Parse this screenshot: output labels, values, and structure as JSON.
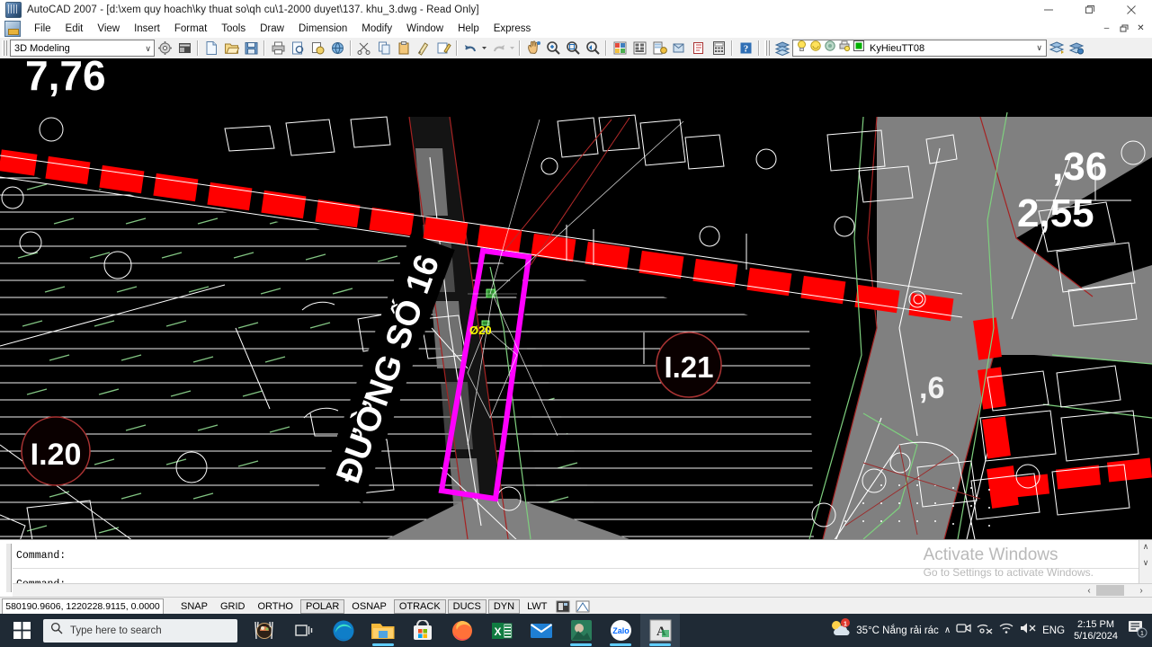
{
  "titlebar": {
    "text": "AutoCAD 2007 - [d:\\xem quy hoach\\ky thuat so\\qh cu\\1-2000 duyet\\137. khu_3.dwg - Read Only]",
    "icon": "autocad-app-icon",
    "minimize": "—",
    "maximize": "❐",
    "close": "✕"
  },
  "menubar": {
    "items": [
      {
        "label": "File"
      },
      {
        "label": "Edit"
      },
      {
        "label": "View"
      },
      {
        "label": "Insert"
      },
      {
        "label": "Format"
      },
      {
        "label": "Tools"
      },
      {
        "label": "Draw"
      },
      {
        "label": "Dimension"
      },
      {
        "label": "Modify"
      },
      {
        "label": "Window"
      },
      {
        "label": "Help"
      },
      {
        "label": "Express"
      }
    ],
    "doc_controls": {
      "minimize": "–",
      "restore": "❐",
      "close": "✕"
    }
  },
  "toolbar": {
    "workspace": {
      "value": "3D Modeling",
      "arrow": "∨"
    },
    "layer": {
      "value": "KyHieuTT08",
      "arrow": "∨"
    },
    "buttons": [
      {
        "name": "workspace-settings-icon"
      },
      {
        "name": "workspace-my-icon"
      },
      {
        "name": "qnew-icon"
      },
      {
        "name": "open-icon"
      },
      {
        "name": "save-icon"
      },
      {
        "name": "plot-icon"
      },
      {
        "name": "plot-preview-icon"
      },
      {
        "name": "publish-icon"
      },
      {
        "name": "3dprint-icon"
      },
      {
        "name": "cut-icon"
      },
      {
        "name": "copy-icon"
      },
      {
        "name": "paste-icon"
      },
      {
        "name": "matchprop-icon"
      },
      {
        "name": "block-editor-icon"
      },
      {
        "name": "undo-icon"
      },
      {
        "name": "undo-dropdown-icon"
      },
      {
        "name": "redo-icon"
      },
      {
        "name": "redo-dropdown-icon"
      },
      {
        "name": "pan-icon"
      },
      {
        "name": "zoom-realtime-icon"
      },
      {
        "name": "zoom-window-icon"
      },
      {
        "name": "zoom-previous-icon"
      },
      {
        "name": "properties-icon"
      },
      {
        "name": "designcenter-icon"
      },
      {
        "name": "tool-palettes-icon"
      },
      {
        "name": "sheet-set-icon"
      },
      {
        "name": "markup-set-icon"
      },
      {
        "name": "quickcalc-icon"
      },
      {
        "name": "help-icon"
      },
      {
        "name": "layer-manager-icon"
      },
      {
        "name": "layer-previous-icon"
      },
      {
        "name": "layer-state-icon"
      }
    ],
    "layer_status_icons": [
      "lightbulb-on-icon",
      "sun-freeze-icon",
      "lock-open-icon",
      "plot-icon",
      "layer-color-swatch"
    ]
  },
  "drawing": {
    "labels": [
      {
        "text": "7,76",
        "kind": "elevation-text"
      },
      {
        "text": "ĐƯỜNG SỐ 16",
        "kind": "street-name-text"
      },
      {
        "text": "I.20",
        "kind": "parcel-id-text"
      },
      {
        "text": "I.21",
        "kind": "parcel-id-text"
      },
      {
        "text": ",36",
        "kind": "elevation-text"
      },
      {
        "text": "2,55",
        "kind": "elevation-text"
      },
      {
        "text": "Ø20",
        "kind": "pipe-size-text"
      }
    ],
    "colors": {
      "background": "#000000",
      "road_fill": "#808080",
      "red_marker": "#ff0000",
      "magenta_selection": "#ff00ff",
      "green_line": "#7ecf7e",
      "white_line": "#ffffff",
      "yellow_text": "#ffff00",
      "dark_red": "#8b1a1a"
    }
  },
  "command_window": {
    "lines": [
      "Command:",
      "Command:"
    ],
    "scroll_up": "∧",
    "scroll_down": "∨",
    "scroll_left": "‹",
    "scroll_right": "›"
  },
  "watermark": {
    "title": "Activate Windows",
    "subtitle": "Go to Settings to activate Windows."
  },
  "statusbar": {
    "coordinates": "580190.9606, 1220228.9115, 0.0000",
    "toggles": [
      {
        "label": "SNAP",
        "active": false
      },
      {
        "label": "GRID",
        "active": false
      },
      {
        "label": "ORTHO",
        "active": false
      },
      {
        "label": "POLAR",
        "active": true
      },
      {
        "label": "OSNAP",
        "active": false
      },
      {
        "label": "OTRACK",
        "active": true
      },
      {
        "label": "DUCS",
        "active": true
      },
      {
        "label": "DYN",
        "active": true
      },
      {
        "label": "LWT",
        "active": false
      }
    ],
    "icons": [
      "model-space-icon",
      "annotation-scale-icon"
    ]
  },
  "taskbar": {
    "start": "windows-start-icon",
    "search_placeholder": "Type here to search",
    "search_icon": "search-icon",
    "widget_icon": "food-widget-icon",
    "taskview_icon": "task-view-icon",
    "apps": [
      {
        "name": "microsoft-edge-icon",
        "active": false
      },
      {
        "name": "file-explorer-icon",
        "active": true
      },
      {
        "name": "microsoft-store-icon",
        "active": false
      },
      {
        "name": "firefox-icon",
        "active": false
      },
      {
        "name": "excel-icon",
        "active": false
      },
      {
        "name": "mail-icon",
        "active": false
      },
      {
        "name": "photo-app-icon",
        "active": true
      },
      {
        "name": "zalo-icon",
        "active": true
      },
      {
        "name": "autocad-icon",
        "active": true
      }
    ],
    "tray": {
      "weather_icon": "weather-partly-cloudy-icon",
      "weather_text": "35°C  Nắng rải rác",
      "chevron": "∧",
      "icons": [
        "meet-now-icon",
        "network-unavailable-icon",
        "wifi-icon",
        "volume-muted-icon"
      ],
      "language": "ENG",
      "time": "2:15 PM",
      "date": "5/16/2024",
      "notification_icon": "notification-icon",
      "notification_count": "1"
    }
  }
}
